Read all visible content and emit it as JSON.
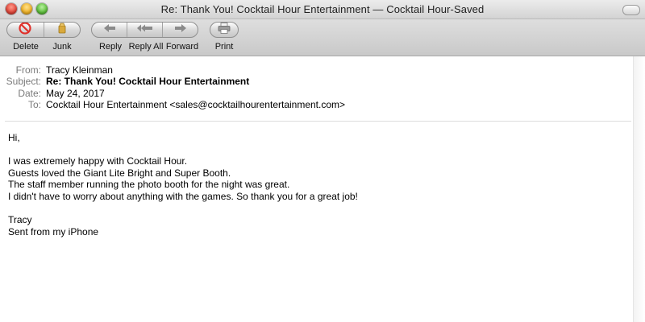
{
  "window": {
    "title": "Re: Thank You! Cocktail Hour Entertainment — Cocktail Hour-Saved"
  },
  "toolbar": {
    "delete_label": "Delete",
    "junk_label": "Junk",
    "reply_label": "Reply",
    "reply_all_label": "Reply All",
    "forward_label": "Forward",
    "print_label": "Print"
  },
  "headers": {
    "from_key": "From:",
    "from_value": "Tracy Kleinman",
    "subject_key": "Subject:",
    "subject_value": "Re: Thank You! Cocktail Hour Entertainment",
    "date_key": "Date:",
    "date_value": "May 24, 2017",
    "to_key": "To:",
    "to_value": "Cocktail Hour Entertainment <sales@cocktailhourentertainment.com>"
  },
  "message": {
    "greeting": "Hi,",
    "line1": "I was extremely happy with Cocktail Hour.",
    "line2": "Guests loved the Giant Lite Bright and Super Booth.",
    "line3": "The staff member running the photo booth for the night was great.",
    "line4": "I didn't have to worry about anything with the games. So thank you for a great job!",
    "signature_name": "Tracy",
    "signature_note": "Sent from my iPhone"
  },
  "icons": {
    "delete": "no-entry-icon",
    "junk": "junk-bag-icon",
    "reply": "reply-arrow-icon",
    "reply_all": "reply-all-arrow-icon",
    "forward": "forward-arrow-icon",
    "print": "printer-icon"
  },
  "colors": {
    "delete_red": "#e0302a",
    "junk_gold": "#c99a2e",
    "arrow_gray": "#8a8a8a",
    "header_key_gray": "#7a7a7a"
  }
}
